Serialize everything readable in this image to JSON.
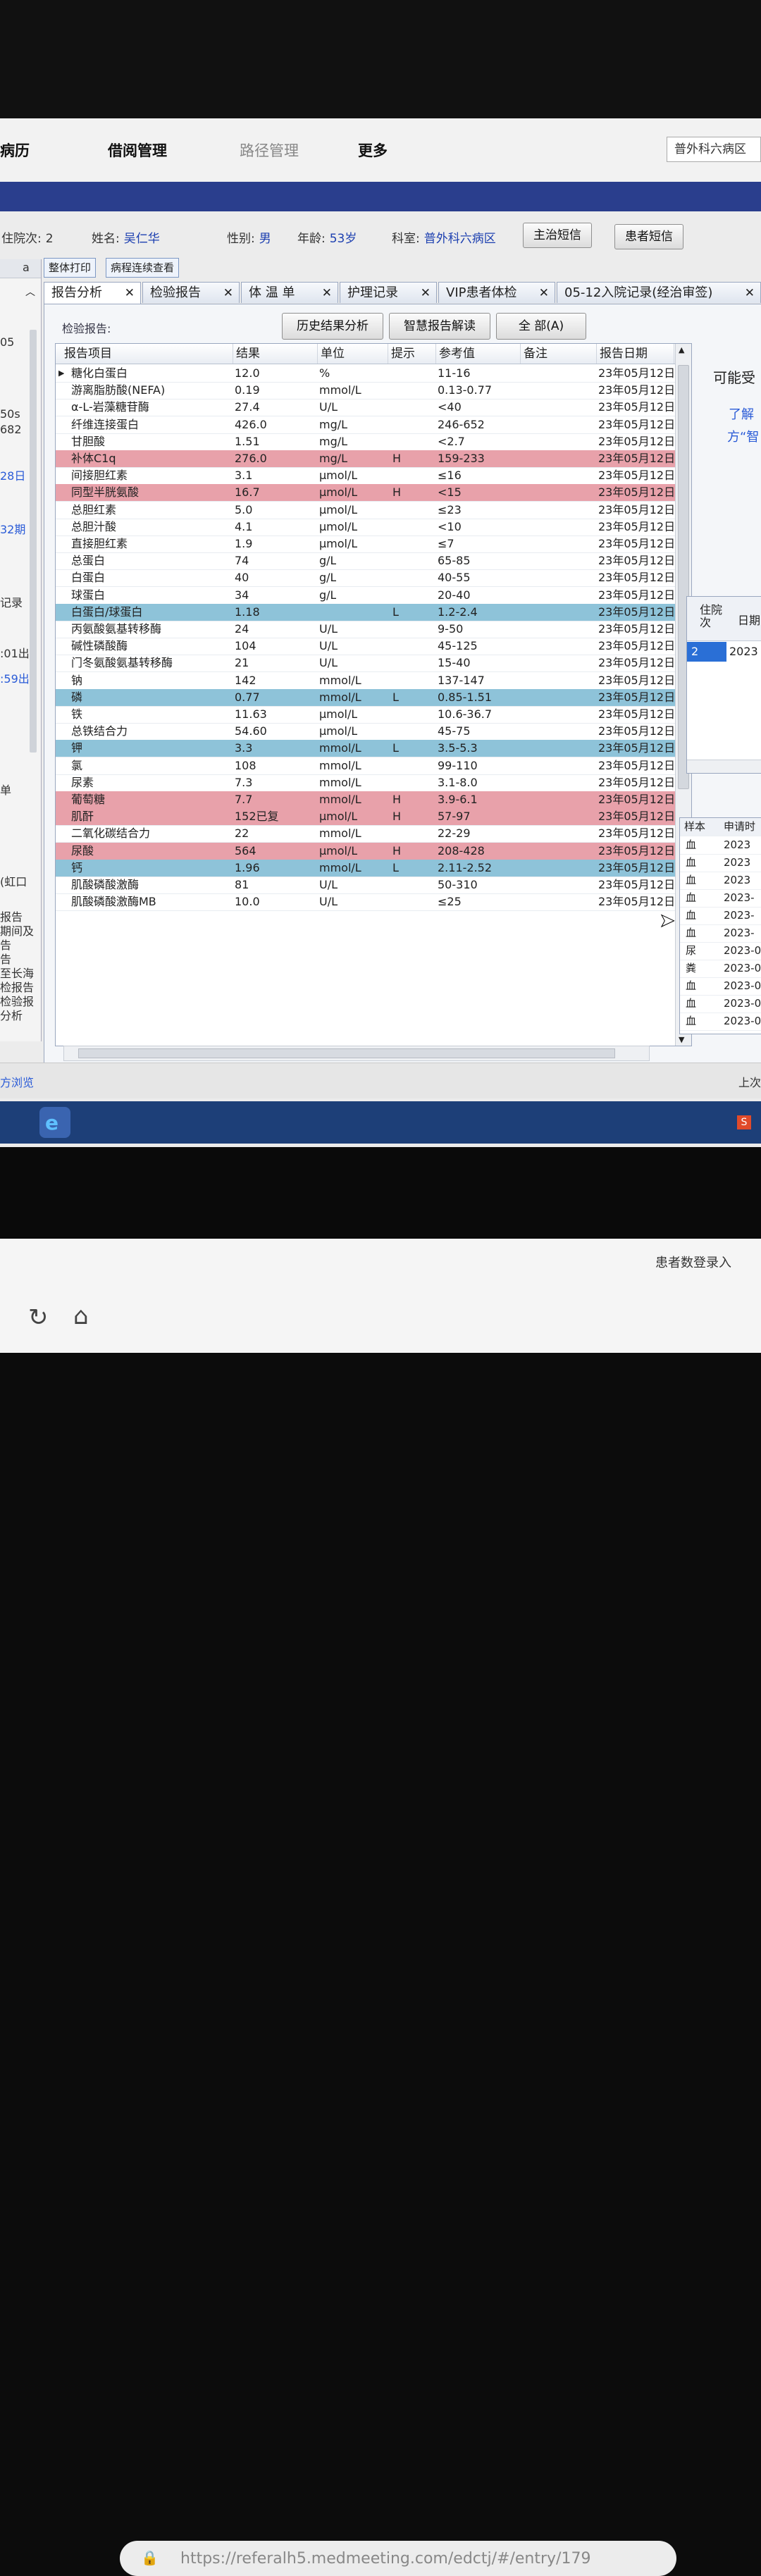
{
  "menu": {
    "left_fragment": "病历",
    "items": [
      "借阅管理",
      "路径管理",
      "更多"
    ],
    "dept_box": "普外科六病区"
  },
  "patient": {
    "visit_label": "住院次:",
    "visit_value": "2",
    "name_label": "姓名:",
    "name_value": "吴仁华",
    "sex_label": "性别:",
    "sex_value": "男",
    "age_label": "年龄:",
    "age_value": "53岁",
    "dept_label": "科室:",
    "dept_value": "普外科六病区",
    "btn_doctor_sms": "主治短信",
    "btn_patient_sms": "患者短信"
  },
  "toolbar": {
    "print_all": "整体打印",
    "continuous_view": "病程连续查看"
  },
  "tabs": [
    {
      "label": "报告分析",
      "active": true
    },
    {
      "label": "检验报告"
    },
    {
      "label": "体 温 单"
    },
    {
      "label": "护理记录"
    },
    {
      "label": "VIP患者体检"
    },
    {
      "label": "05-12入院记录(经治审签)"
    }
  ],
  "report": {
    "label": "检验报告:",
    "btn_history": "历史结果分析",
    "btn_smart": "智慧报告解读",
    "btn_all": "全 部(A)",
    "columns": [
      "报告项目",
      "结果",
      "单位",
      "提示",
      "参考值",
      "备注",
      "报告日期"
    ],
    "rows": [
      {
        "item": "糖化白蛋白",
        "result": "12.0",
        "unit": "%",
        "flag": "",
        "ref": "11-16",
        "date": "23年05月12日"
      },
      {
        "item": "游离脂肪酸(NEFA)",
        "result": "0.19",
        "unit": "mmol/L",
        "flag": "",
        "ref": "0.13-0.77",
        "date": "23年05月12日"
      },
      {
        "item": "α-L-岩藻糖苷酶",
        "result": "27.4",
        "unit": "U/L",
        "flag": "",
        "ref": "<40",
        "date": "23年05月12日"
      },
      {
        "item": "纤维连接蛋白",
        "result": "426.0",
        "unit": "mg/L",
        "flag": "",
        "ref": "246-652",
        "date": "23年05月12日"
      },
      {
        "item": "甘胆酸",
        "result": "1.51",
        "unit": "mg/L",
        "flag": "",
        "ref": "<2.7",
        "date": "23年05月12日"
      },
      {
        "item": "补体C1q",
        "result": "276.0",
        "unit": "mg/L",
        "flag": "H",
        "ref": "159-233",
        "date": "23年05月12日"
      },
      {
        "item": "间接胆红素",
        "result": "3.1",
        "unit": "μmol/L",
        "flag": "",
        "ref": "≤16",
        "date": "23年05月12日"
      },
      {
        "item": "同型半胱氨酸",
        "result": "16.7",
        "unit": "μmol/L",
        "flag": "H",
        "ref": "<15",
        "date": "23年05月12日"
      },
      {
        "item": "总胆红素",
        "result": "5.0",
        "unit": "μmol/L",
        "flag": "",
        "ref": "≤23",
        "date": "23年05月12日"
      },
      {
        "item": "总胆汁酸",
        "result": "4.1",
        "unit": "μmol/L",
        "flag": "",
        "ref": "<10",
        "date": "23年05月12日"
      },
      {
        "item": "直接胆红素",
        "result": "1.9",
        "unit": "μmol/L",
        "flag": "",
        "ref": "≤7",
        "date": "23年05月12日"
      },
      {
        "item": "总蛋白",
        "result": "74",
        "unit": "g/L",
        "flag": "",
        "ref": "65-85",
        "date": "23年05月12日"
      },
      {
        "item": "白蛋白",
        "result": "40",
        "unit": "g/L",
        "flag": "",
        "ref": "40-55",
        "date": "23年05月12日"
      },
      {
        "item": "球蛋白",
        "result": "34",
        "unit": "g/L",
        "flag": "",
        "ref": "20-40",
        "date": "23年05月12日"
      },
      {
        "item": "白蛋白/球蛋白",
        "result": "1.18",
        "unit": "",
        "flag": "L",
        "ref": "1.2-2.4",
        "date": "23年05月12日"
      },
      {
        "item": "丙氨酸氨基转移酶",
        "result": "24",
        "unit": "U/L",
        "flag": "",
        "ref": "9-50",
        "date": "23年05月12日"
      },
      {
        "item": "碱性磷酸酶",
        "result": "104",
        "unit": "U/L",
        "flag": "",
        "ref": "45-125",
        "date": "23年05月12日"
      },
      {
        "item": "门冬氨酸氨基转移酶",
        "result": "21",
        "unit": "U/L",
        "flag": "",
        "ref": "15-40",
        "date": "23年05月12日"
      },
      {
        "item": "钠",
        "result": "142",
        "unit": "mmol/L",
        "flag": "",
        "ref": "137-147",
        "date": "23年05月12日"
      },
      {
        "item": "磷",
        "result": "0.77",
        "unit": "mmol/L",
        "flag": "L",
        "ref": "0.85-1.51",
        "date": "23年05月12日"
      },
      {
        "item": "铁",
        "result": "11.63",
        "unit": "μmol/L",
        "flag": "",
        "ref": "10.6-36.7",
        "date": "23年05月12日"
      },
      {
        "item": "总铁结合力",
        "result": "54.60",
        "unit": "μmol/L",
        "flag": "",
        "ref": "45-75",
        "date": "23年05月12日"
      },
      {
        "item": "钾",
        "result": "3.3",
        "unit": "mmol/L",
        "flag": "L",
        "ref": "3.5-5.3",
        "date": "23年05月12日"
      },
      {
        "item": "氯",
        "result": "108",
        "unit": "mmol/L",
        "flag": "",
        "ref": "99-110",
        "date": "23年05月12日"
      },
      {
        "item": "尿素",
        "result": "7.3",
        "unit": "mmol/L",
        "flag": "",
        "ref": "3.1-8.0",
        "date": "23年05月12日"
      },
      {
        "item": "葡萄糖",
        "result": "7.7",
        "unit": "mmol/L",
        "flag": "H",
        "ref": "3.9-6.1",
        "date": "23年05月12日"
      },
      {
        "item": "肌酐",
        "result": "152已复",
        "unit": "μmol/L",
        "flag": "H",
        "ref": "57-97",
        "date": "23年05月12日"
      },
      {
        "item": "二氧化碳结合力",
        "result": "22",
        "unit": "mmol/L",
        "flag": "",
        "ref": "22-29",
        "date": "23年05月12日"
      },
      {
        "item": "尿酸",
        "result": "564",
        "unit": "μmol/L",
        "flag": "H",
        "ref": "208-428",
        "date": "23年05月12日"
      },
      {
        "item": "钙",
        "result": "1.96",
        "unit": "mmol/L",
        "flag": "L",
        "ref": "2.11-2.52",
        "date": "23年05月12日"
      },
      {
        "item": "肌酸磷酸激酶",
        "result": "81",
        "unit": "U/L",
        "flag": "",
        "ref": "50-310",
        "date": "23年05月12日"
      },
      {
        "item": "肌酸磷酸激酶MB",
        "result": "10.0",
        "unit": "U/L",
        "flag": "",
        "ref": "≤25",
        "date": "23年05月12日"
      }
    ]
  },
  "right_panel": {
    "text1": "可能受",
    "text2": "了解",
    "text3": "方“智",
    "mini_head_1": "住院次",
    "mini_head_2": "日期",
    "mini_row_visit": "2",
    "mini_row_date": "2023",
    "sample_head_1": "样本",
    "sample_head_2": "申请时",
    "samples": [
      {
        "type": "血",
        "date": "2023"
      },
      {
        "type": "血",
        "date": "2023"
      },
      {
        "type": "血",
        "date": "2023"
      },
      {
        "type": "血",
        "date": "2023-"
      },
      {
        "type": "血",
        "date": "2023-"
      },
      {
        "type": "血",
        "date": "2023-"
      },
      {
        "type": "尿",
        "date": "2023-0"
      },
      {
        "type": "粪",
        "date": "2023-0"
      },
      {
        "type": "血",
        "date": "2023-0"
      },
      {
        "type": "血",
        "date": "2023-0"
      },
      {
        "type": "血",
        "date": "2023-0"
      }
    ]
  },
  "left_panel": {
    "items": [
      "a",
      "05",
      "50s",
      "682",
      "28日",
      "32期",
      "记录",
      ":01出",
      ":59出",
      "单",
      "(虹口",
      "报告",
      "期间及",
      "告",
      "告",
      "至长海",
      "检报告",
      "检验报",
      "分析"
    ]
  },
  "status": {
    "left": "方浏览",
    "right": "上次"
  },
  "phone": {
    "notify": "患者数登录入",
    "url": "https://referalh5.medmeeting.com/edctj/#/entry/179"
  }
}
